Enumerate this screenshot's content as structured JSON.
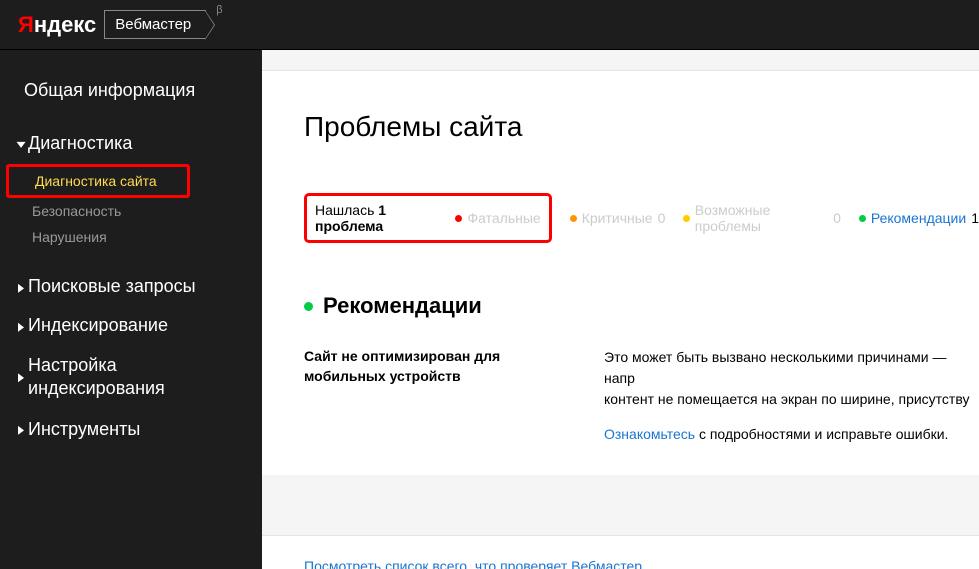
{
  "header": {
    "logo_prefix": "Я",
    "logo_rest": "ндекс",
    "service": "Вебмастер",
    "beta": "β"
  },
  "sidebar": {
    "general": "Общая информация",
    "diagnostics": {
      "title": "Диагностика",
      "items": [
        "Диагностика сайта",
        "Безопасность",
        "Нарушения"
      ]
    },
    "search_queries": "Поисковые запросы",
    "indexing": "Индексирование",
    "indexing_settings": "Настройка индексирования",
    "tools": "Инструменты"
  },
  "main": {
    "title": "Проблемы сайта",
    "filters": {
      "found_label": "Нашлась ",
      "found_count": "1 проблема",
      "fatal": "Фатальные",
      "critical": "Критичные",
      "critical_count": "0",
      "possible": "Возможные проблемы",
      "possible_count": "0",
      "recommendations": "Рекомендации",
      "recommendations_count": "1"
    },
    "section": {
      "title": "Рекомендации",
      "issue_title": "Сайт не оптимизирован для мобильных устройств",
      "description_1": "Это может быть вызвано несколькими причинами — напр",
      "description_2": "контент не помещается на экран по ширине, присутству",
      "link_text": "Ознакомьтесь",
      "link_suffix": " с подробностями и исправьте ошибки."
    },
    "footer_link": "Посмотреть список всего, что проверяет Вебмастер"
  }
}
